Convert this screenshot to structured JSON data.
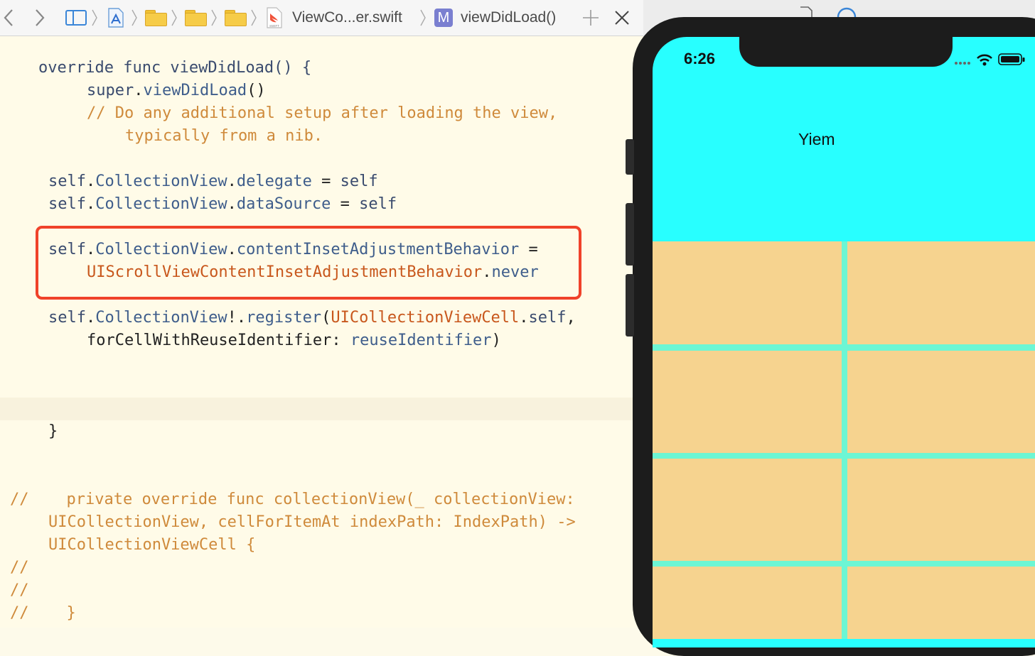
{
  "jumpbar": {
    "file_name": "ViewCo...er.swift",
    "method_badge": "M",
    "method_name": "viewDidLoad()",
    "swift_badge": "SWIFT"
  },
  "code_lines": [
    "override func viewDidLoad() {",
    "super",
    ".",
    "viewDidLoad",
    "()",
    "// Do any additional setup after loading the view,",
    "typically from a nib.",
    "self",
    "CollectionView",
    "delegate",
    " = ",
    "dataSource",
    "contentInsetAdjustmentBehavior",
    "UIScrollViewContentInsetAdjustmentBehavior",
    "never",
    "!.",
    "register",
    "(",
    "UICollectionViewCell",
    "self",
    ",",
    "forCellWithReuseIdentifier: ",
    "reuseIdentifier",
    ")",
    "}",
    "//",
    "    private override func collectionView(_ collectionView:",
    "UICollectionView, cellForItemAt indexPath: IndexPath) ->",
    "UICollectionViewCell {",
    "    }"
  ],
  "simulator": {
    "time": "6:26",
    "title": "Yiem"
  },
  "colors": {
    "nav_bar": "#28ffff",
    "cell": "#f6d38f",
    "grid_line": "#6cf6d4",
    "highlight": "#f0422a"
  }
}
